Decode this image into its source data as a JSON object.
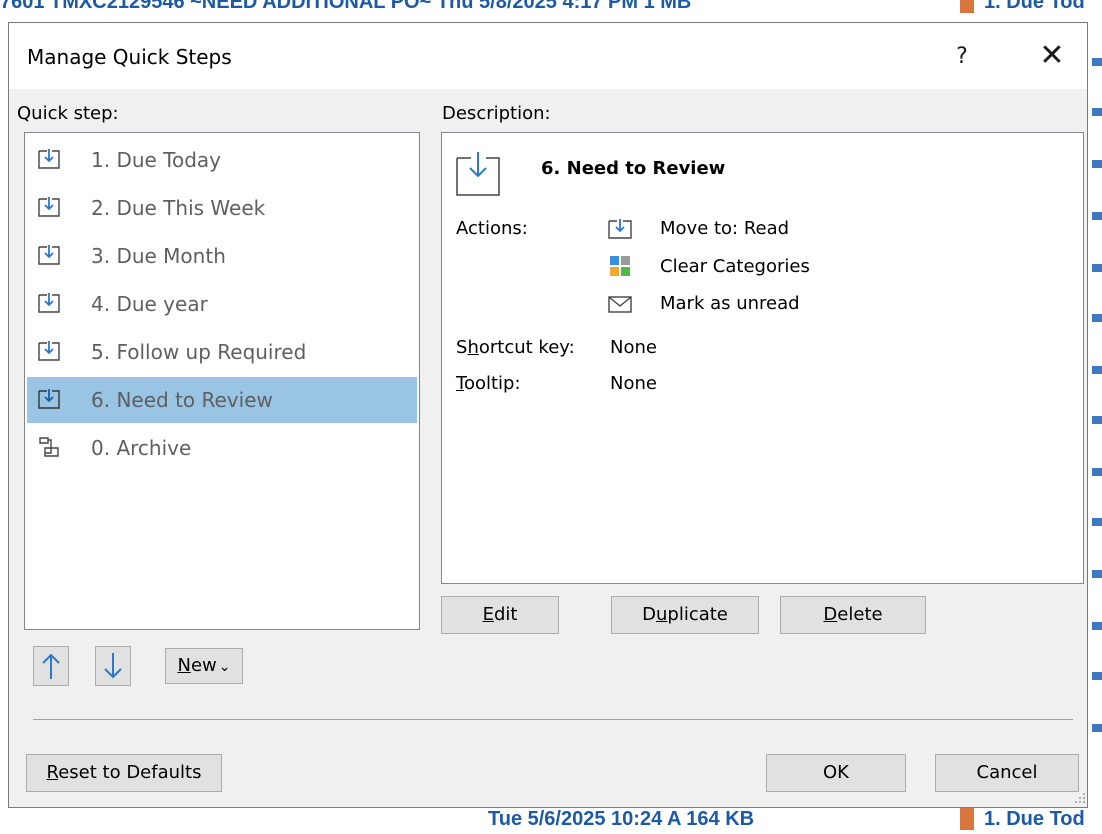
{
  "background": {
    "top_subject": "7601 TMXC2129546 ~NEED ADDITIONAL PO~   Thu 5/8/2025 4:17 PM   1 MB",
    "top_category": "1. Due Tod",
    "bottom_subject": "Tue 5/6/2025 10:24 A     164 KB",
    "bottom_category": "1. Due Tod"
  },
  "dialog": {
    "title": "Manage Quick Steps",
    "help": "?",
    "close": "✕"
  },
  "quick_step": {
    "label": "Quick step:",
    "items": [
      {
        "label": "1. Due Today"
      },
      {
        "label": "2. Due This Week"
      },
      {
        "label": "3. Due Month"
      },
      {
        "label": "4. Due year"
      },
      {
        "label": "5. Follow up Required"
      },
      {
        "label": "6. Need to Review"
      },
      {
        "label": "0. Archive"
      }
    ],
    "selected_index": 5
  },
  "description": {
    "label": "Description:",
    "title": "6. Need to Review",
    "actions_label": "Actions:",
    "actions": [
      {
        "label": "Move to: Read",
        "icon": "move-to-folder-icon"
      },
      {
        "label": "Clear Categories",
        "icon": "categories-icon"
      },
      {
        "label": "Mark as unread",
        "icon": "envelope-icon"
      }
    ],
    "shortcut_label_pre": "S",
    "shortcut_label_u": "h",
    "shortcut_label_post": "ortcut key:",
    "shortcut_value": "None",
    "tooltip_label_u": "T",
    "tooltip_label_post": "ooltip:",
    "tooltip_value": "None"
  },
  "buttons": {
    "edit_u": "E",
    "edit_rest": "dit",
    "duplicate_pre": "D",
    "duplicate_u": "u",
    "duplicate_rest": "plicate",
    "delete_u": "D",
    "delete_rest": "elete",
    "new_u": "N",
    "new_rest": "ew",
    "new_chevron": "⌄",
    "reset_u": "R",
    "reset_rest": "eset to Defaults",
    "ok": "OK",
    "cancel": "Cancel"
  },
  "colors": {
    "selection": "#99c4e4",
    "icon_blue": "#2b78c9",
    "link_blue": "#1c5aa6",
    "category_orange": "#d8763e"
  }
}
